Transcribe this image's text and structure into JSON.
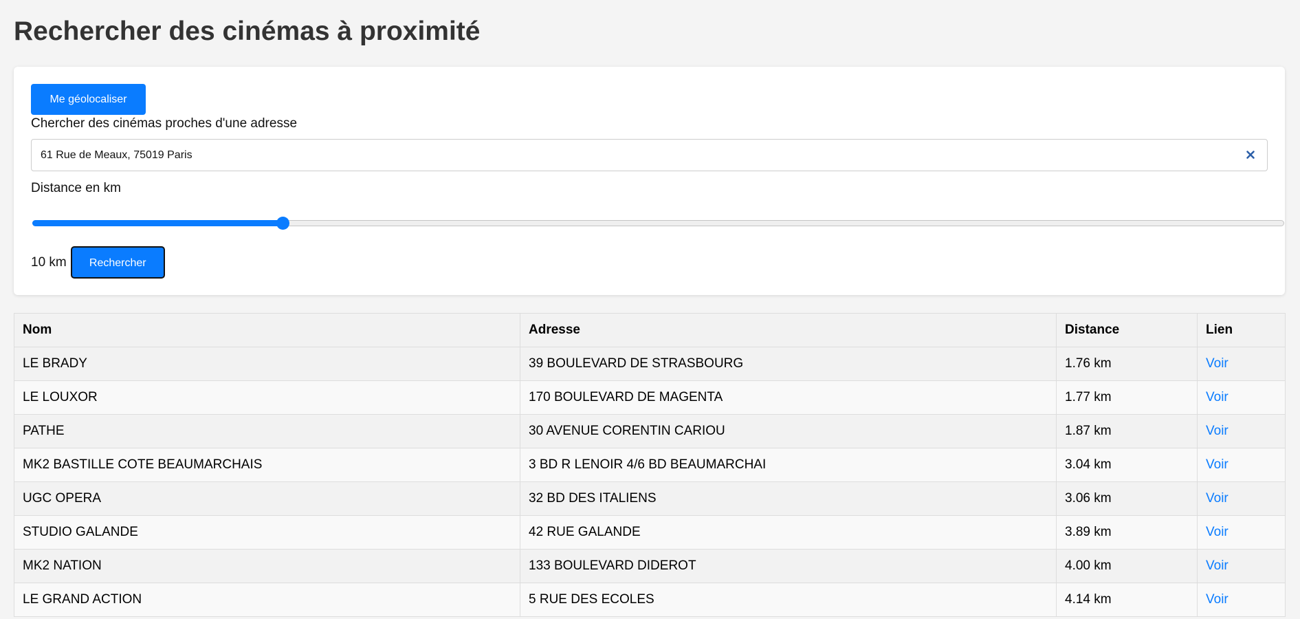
{
  "page": {
    "title": "Rechercher des cinémas à proximité"
  },
  "search": {
    "geo_button": "Me géolocaliser",
    "address_label": "Chercher des cinémas proches d'une adresse",
    "address_value": "61 Rue de Meaux, 75019 Paris",
    "distance_label": "Distance en km",
    "distance_value": 10,
    "distance_min": 0,
    "distance_max": 50,
    "distance_display": "10 km",
    "search_button": "Rechercher"
  },
  "colors": {
    "accent": "#0a7cff",
    "title": "#333333"
  },
  "table": {
    "headers": {
      "name": "Nom",
      "address": "Adresse",
      "distance": "Distance",
      "link": "Lien"
    },
    "rows": [
      {
        "name": "LE BRADY",
        "address": "39 BOULEVARD DE STRASBOURG",
        "distance": "1.76 km",
        "link": "Voir"
      },
      {
        "name": "LE LOUXOR",
        "address": "170 BOULEVARD DE MAGENTA",
        "distance": "1.77 km",
        "link": "Voir"
      },
      {
        "name": "PATHE",
        "address": "30 AVENUE CORENTIN CARIOU",
        "distance": "1.87 km",
        "link": "Voir"
      },
      {
        "name": "MK2 BASTILLE COTE BEAUMARCHAIS",
        "address": "3 BD R LENOIR 4/6 BD BEAUMARCHAI",
        "distance": "3.04 km",
        "link": "Voir"
      },
      {
        "name": "UGC OPERA",
        "address": "32 BD DES ITALIENS",
        "distance": "3.06 km",
        "link": "Voir"
      },
      {
        "name": "STUDIO GALANDE",
        "address": "42 RUE GALANDE",
        "distance": "3.89 km",
        "link": "Voir"
      },
      {
        "name": "MK2 NATION",
        "address": "133 BOULEVARD DIDEROT",
        "distance": "4.00 km",
        "link": "Voir"
      },
      {
        "name": "LE GRAND ACTION",
        "address": "5 RUE DES ECOLES",
        "distance": "4.14 km",
        "link": "Voir"
      }
    ]
  }
}
